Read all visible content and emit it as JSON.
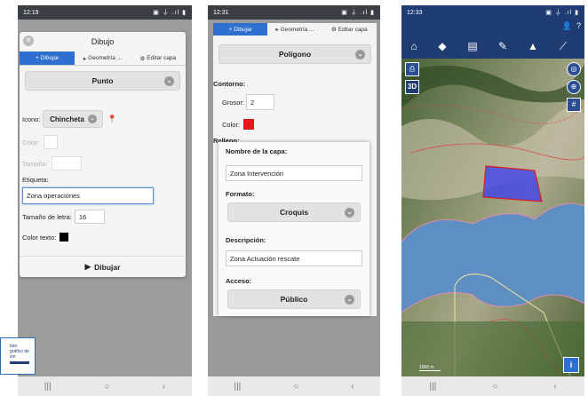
{
  "phone1": {
    "status": {
      "time": "12:19",
      "right": "▣ ⏚ .ıl ▮"
    },
    "dialog_title": "Dibujo",
    "tabs": [
      {
        "label": "Dibujar",
        "icon": "+"
      },
      {
        "label": "Geometría ...",
        "icon": "▸"
      },
      {
        "label": "Editar capa",
        "icon": "⚙"
      }
    ],
    "geometry_select": "Punto",
    "icon_label": "Icono:",
    "icon_value": "Chincheta",
    "color_label": "Color:",
    "size_label": "Tamaño:",
    "tag_label": "Etiqueta:",
    "tag_value": "Zona operaciones",
    "font_size_label": "Tamaño de letra:",
    "font_size_value": "16",
    "text_color_label": "Color texto:",
    "draw_button": "Dibujar"
  },
  "phone2": {
    "status": {
      "time": "12:31",
      "right": "▣ ⏚ .ıl ▮"
    },
    "tabs": [
      {
        "label": "Dibujar",
        "icon": "+"
      },
      {
        "label": "Geometría ...",
        "icon": "▸"
      },
      {
        "label": "Editar capa",
        "icon": "⚙"
      }
    ],
    "geometry_select": "Polígono",
    "contour_label": "Contorno:",
    "thickness_label": "Grosor:",
    "thickness_value": "2",
    "color_label": "Color:",
    "fill_label": "Relleno:",
    "layer_name_label": "Nombre de la capa:",
    "layer_name_value": "Zona Intervención",
    "format_label": "Formato:",
    "format_value": "Croquis",
    "description_label": "Descripción:",
    "description_value": "Zona Actuación rescate",
    "access_label": "Acceso:",
    "access_value": "Público"
  },
  "phone3": {
    "status": {
      "time": "12:33",
      "right": "▣ ⏚ .ıl ▮"
    },
    "btn_3d": "3D",
    "scale_label": "1000 m",
    "info": "i",
    "help": "?"
  },
  "navbar": {
    "recent": "|||",
    "home": "○",
    "back": "‹"
  },
  "logo": {
    "lines": [
      "tuto",
      "gráfico de",
      "ión"
    ]
  },
  "colors": {
    "tab_active": "#2f6fd0",
    "red_swatch": "#e01b1b",
    "toolbar": "#1f3d73",
    "polygon": "#3a3cf0"
  }
}
